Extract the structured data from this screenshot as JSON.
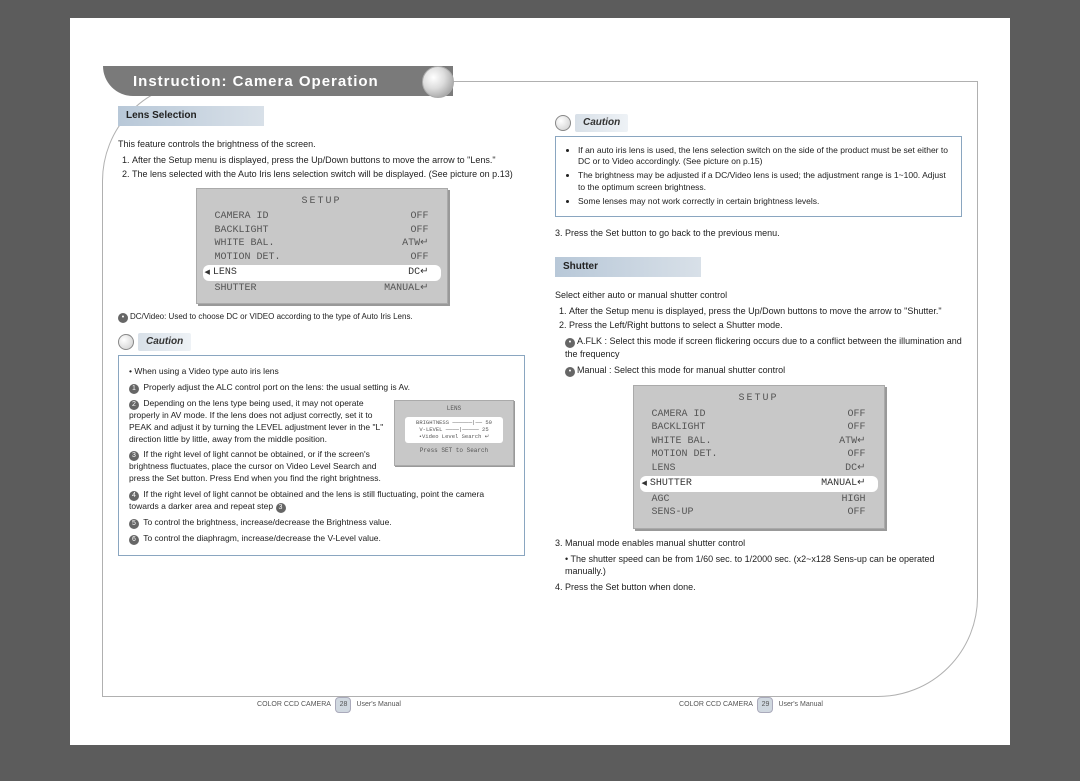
{
  "header": {
    "title": "Instruction: Camera Operation"
  },
  "left": {
    "lens_selection_hd": "Lens Selection",
    "intro": "This feature controls the brightness of the screen.",
    "steps": [
      "After the Setup menu is displayed, press the Up/Down buttons to move the arrow to \"Lens.\"",
      "The lens selected with the Auto Iris lens selection switch will be displayed. (See picture on p.13)"
    ],
    "setup_title": "SETUP",
    "setup_rows": [
      {
        "k": "CAMERA ID",
        "v": "OFF"
      },
      {
        "k": "BACKLIGHT",
        "v": "OFF"
      },
      {
        "k": "WHITE BAL.",
        "v": "ATW↵"
      },
      {
        "k": "MOTION DET.",
        "v": "OFF"
      },
      {
        "k": "LENS",
        "v": "DC↵",
        "selected": true
      },
      {
        "k": "SHUTTER",
        "v": "MANUAL↵"
      }
    ],
    "dcvideo_note": "DC/Video: Used to choose DC or VIDEO according to the type of Auto Iris Lens.",
    "caution_label": "Caution",
    "caution1_lines": [
      "When using a Video type auto iris lens",
      "Properly adjust the ALC control port on the lens: the usual setting is Av.",
      "Depending on the lens type being used, it may not operate properly in AV mode. If the lens does not adjust correctly, set it to PEAK and adjust it by turning the LEVEL adjustment lever in the \"L\" direction little by little, away from the middle position.",
      "If the right level of light cannot be obtained, or if the screen's brightness fluctuates, place the cursor on Video Level Search and press the Set button. Press End when you find the right brightness.",
      "If the right level of light cannot be obtained and the lens is still fluctuating, point the camera towards a darker area and repeat step",
      "To control the brightness, increase/decrease the Brightness value.",
      "To control the diaphragm, increase/decrease the V-Level value."
    ],
    "mini_title": "LENS",
    "mini_rows": [
      "BRIGHTNESS ——————|—— 50",
      "V-LEVEL ————|————— 25",
      "•Video Level Search ↵"
    ],
    "mini_foot": "Press SET to Search"
  },
  "right": {
    "caution_label": "Caution",
    "caution2_lines": [
      "If an auto iris lens is used, the lens selection switch on the side of the product must be set either to DC or to Video accordingly. (See picture on p.15)",
      "The brightness may be adjusted if a DC/Video lens is used; the adjustment range is 1~100. Adjust to the optimum screen brightness.",
      "Some lenses may not work correctly in certain brightness levels."
    ],
    "step3": "Press the Set button to go back to the previous menu.",
    "shutter_hd": "Shutter",
    "shutter_intro": "Select either auto or manual shutter control",
    "shutter_steps": [
      "After the Setup menu is displayed, press the Up/Down buttons to move the arrow to \"Shutter.\"",
      "Press the Left/Right buttons to select a Shutter mode."
    ],
    "aflk_label": "A.FLK",
    "aflk_desc": ": Select this mode if screen flickering occurs due to a conflict between the illumination and the frequency",
    "manual_label": "Manual",
    "manual_desc": ": Select this mode for manual shutter control",
    "setup_title": "SETUP",
    "setup_rows": [
      {
        "k": "CAMERA ID",
        "v": "OFF"
      },
      {
        "k": "BACKLIGHT",
        "v": "OFF"
      },
      {
        "k": "WHITE BAL.",
        "v": "ATW↵"
      },
      {
        "k": "MOTION DET.",
        "v": "OFF"
      },
      {
        "k": "LENS",
        "v": "DC↵"
      },
      {
        "k": "SHUTTER",
        "v": "MANUAL↵",
        "selected": true
      },
      {
        "k": "AGC",
        "v": "HIGH"
      },
      {
        "k": "SENS-UP",
        "v": "OFF"
      }
    ],
    "step3b": "Manual mode enables manual shutter control",
    "step3b_sub": "The shutter speed can be from 1/60 sec. to 1/2000 sec. (x2~x128 Sens-up can be operated manually.)",
    "step4": "Press the Set button when done."
  },
  "footer": {
    "left_pre": "COLOR CCD CAMERA",
    "left_num": "28",
    "suffix": "User's Manual",
    "right_pre": "COLOR CCD CAMERA",
    "right_num": "29"
  }
}
